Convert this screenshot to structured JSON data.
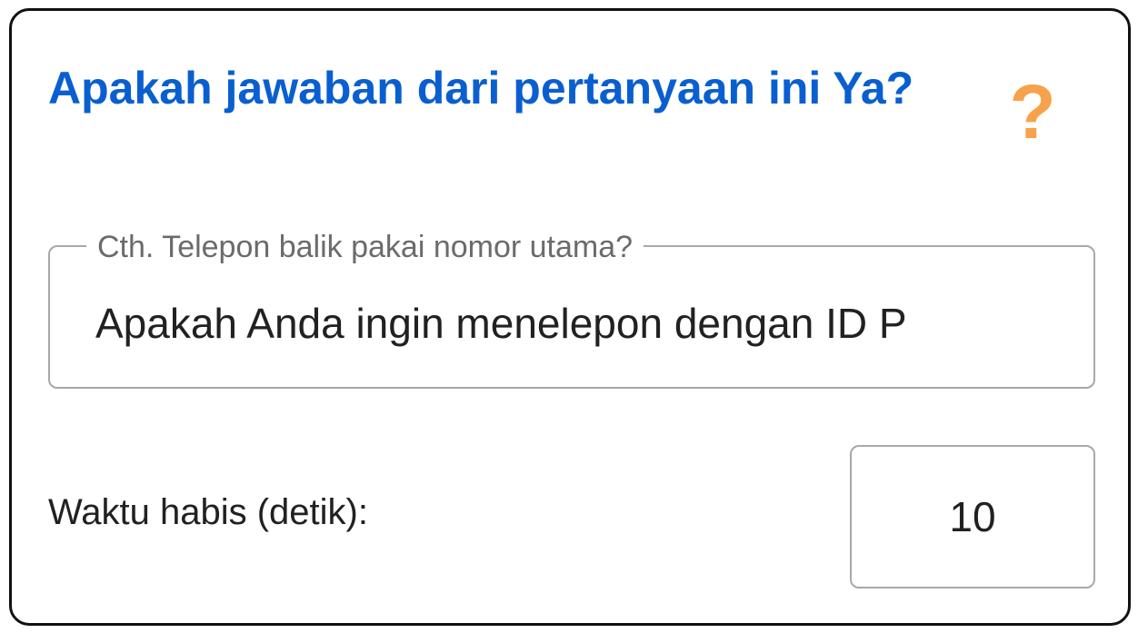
{
  "dialog": {
    "title": "Apakah jawaban dari pertanyaan ini Ya?",
    "help_icon": "question-mark-icon",
    "help_glyph": "?"
  },
  "question_field": {
    "placeholder": "Cth. Telepon balik pakai nomor utama?",
    "value": "Apakah Anda ingin menelepon dengan ID P"
  },
  "timeout": {
    "label": "Waktu habis (detik):",
    "value": "10"
  },
  "colors": {
    "title": "#0a5fd0",
    "help_icon": "#f7a24a",
    "border": "#111111",
    "field_border": "#a8a8a8"
  }
}
